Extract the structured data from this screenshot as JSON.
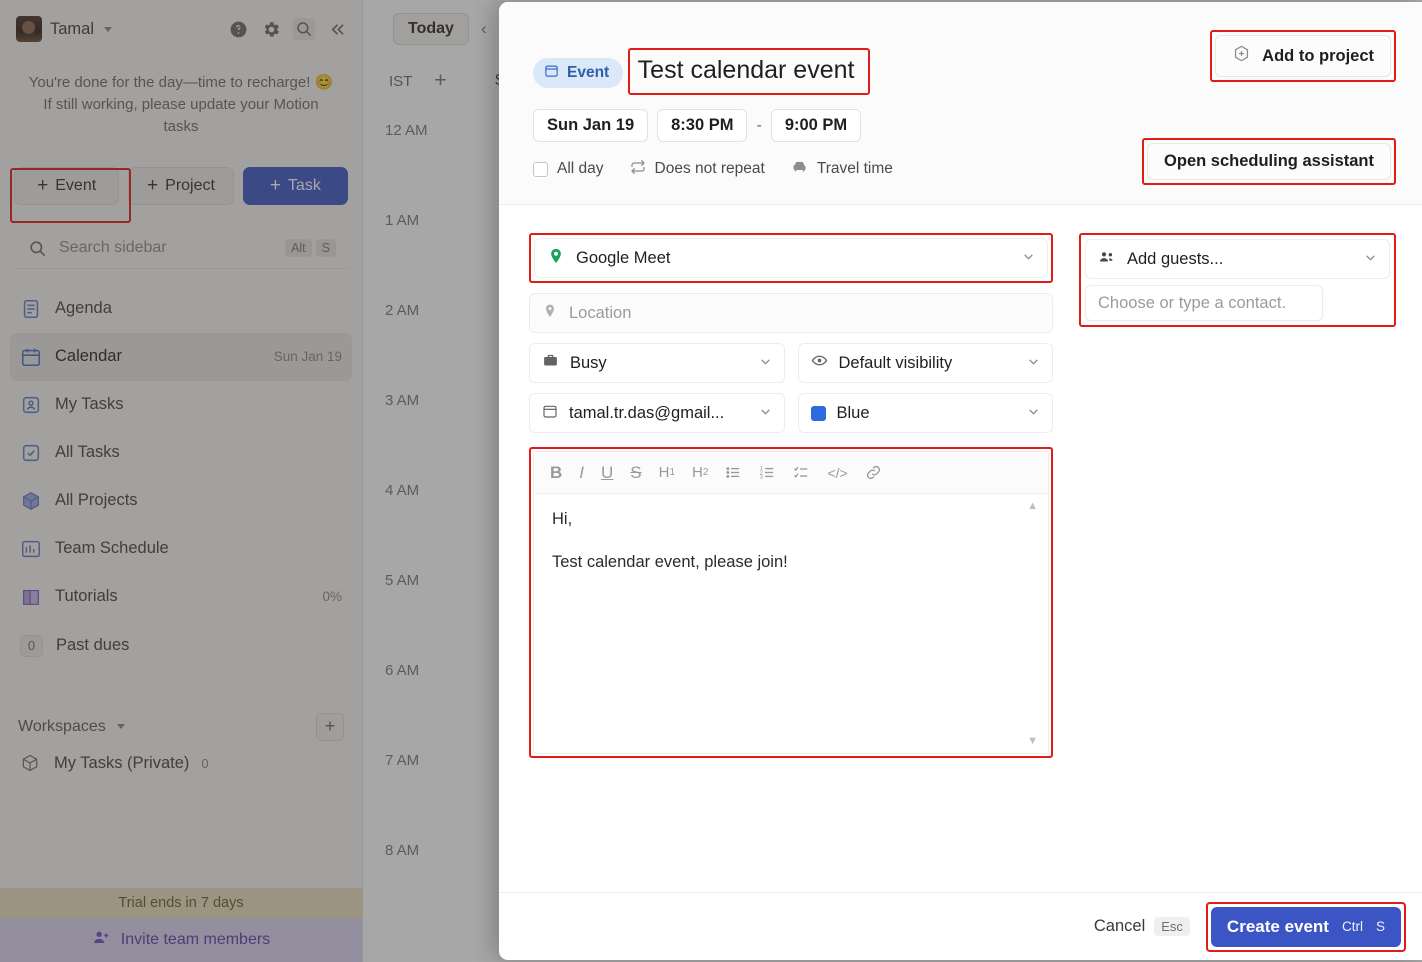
{
  "sidebar": {
    "user": {
      "name": "Tamal",
      "avatar_alt": "user-avatar"
    },
    "top_icons": [
      "help-icon",
      "gear-icon",
      "search-icon",
      "collapse-icon"
    ],
    "notice": "You're done for the day—time to recharge! 😊 If still working, please update your Motion tasks",
    "quick_actions": [
      {
        "label": "Event",
        "icon": "plus-icon",
        "style": "default"
      },
      {
        "label": "Project",
        "icon": "plus-icon",
        "style": "default"
      },
      {
        "label": "Task",
        "icon": "plus-icon",
        "style": "primary"
      }
    ],
    "search": {
      "placeholder": "Search sidebar",
      "shortcut_alt": "Alt",
      "shortcut_key": "S"
    },
    "nav_items": [
      {
        "label": "Agenda",
        "icon": "agenda-icon",
        "meta": "",
        "active": false
      },
      {
        "label": "Calendar",
        "icon": "calendar-icon",
        "meta": "Sun Jan 19",
        "active": true
      },
      {
        "label": "My Tasks",
        "icon": "my-tasks-icon",
        "meta": "",
        "active": false
      },
      {
        "label": "All Tasks",
        "icon": "all-tasks-icon",
        "meta": "",
        "active": false
      },
      {
        "label": "All Projects",
        "icon": "all-projects-icon",
        "meta": "",
        "active": false
      },
      {
        "label": "Team Schedule",
        "icon": "team-schedule-icon",
        "meta": "",
        "active": false
      },
      {
        "label": "Tutorials",
        "icon": "tutorials-icon",
        "meta": "0%",
        "active": false
      }
    ],
    "past_dues": {
      "count": "0",
      "label": "Past dues"
    },
    "workspaces": {
      "header": "Workspaces",
      "add_label": "+",
      "items": [
        {
          "label": "My Tasks (Private)",
          "count": "0"
        }
      ]
    },
    "trial_banner": "Trial ends in 7 days",
    "invite_label": "Invite team members"
  },
  "calendar": {
    "today_label": "Today",
    "prev_arrow": "‹",
    "timezone": "IST",
    "add_timezone": "+",
    "day_label": "S",
    "hours": [
      "12 AM",
      "1 AM",
      "2 AM",
      "3 AM",
      "4 AM",
      "5 AM",
      "6 AM",
      "7 AM",
      "8 AM"
    ]
  },
  "modal": {
    "type_badge": {
      "label": "Event",
      "icon": "calendar-icon"
    },
    "title": "Test calendar event",
    "date": "Sun Jan 19",
    "start_time": "8:30 PM",
    "time_separator": "-",
    "end_time": "9:00 PM",
    "options": [
      {
        "label": "All day",
        "icon": "checkbox-icon"
      },
      {
        "label": "Does not repeat",
        "icon": "repeat-icon"
      },
      {
        "label": "Travel time",
        "icon": "car-icon"
      }
    ],
    "add_to_project": {
      "label": "Add to project",
      "icon": "plus-hex-icon"
    },
    "scheduling_assistant": {
      "label": "Open scheduling assistant"
    },
    "conference": {
      "value": "Google Meet",
      "icon": "google-meet-icon"
    },
    "location": {
      "placeholder": "Location",
      "icon": "pin-icon"
    },
    "availability": {
      "value": "Busy",
      "icon": "briefcase-icon"
    },
    "visibility": {
      "value": "Default visibility",
      "icon": "eye-icon"
    },
    "calendar_account": {
      "value": "tamal.tr.das@gmail...",
      "icon": "calendar-icon"
    },
    "color": {
      "value": "Blue",
      "hex": "#2f6be0"
    },
    "guests": {
      "label": "Add guests...",
      "icon": "people-icon",
      "input_placeholder": "Choose or type a contact."
    },
    "editor": {
      "toolbar": [
        {
          "name": "bold-icon",
          "glyph": "B"
        },
        {
          "name": "italic-icon",
          "glyph": "I"
        },
        {
          "name": "underline-icon",
          "glyph": "U"
        },
        {
          "name": "strikethrough-icon",
          "glyph": "S"
        },
        {
          "name": "heading-1-icon",
          "glyph": "H1"
        },
        {
          "name": "heading-2-icon",
          "glyph": "H2"
        },
        {
          "name": "bullet-list-icon",
          "glyph": "☰"
        },
        {
          "name": "numbered-list-icon",
          "glyph": "☰"
        },
        {
          "name": "checklist-icon",
          "glyph": "☰"
        },
        {
          "name": "code-icon",
          "glyph": "</>"
        },
        {
          "name": "link-icon",
          "glyph": "🔗"
        }
      ],
      "lines": [
        "Hi,",
        "Test calendar event, please join!"
      ]
    },
    "footer": {
      "cancel_label": "Cancel",
      "cancel_shortcut": "Esc",
      "create_label": "Create event",
      "create_shortcut_mod": "Ctrl",
      "create_shortcut_key": "S"
    }
  },
  "colors": {
    "accent": "#3b55c4",
    "highlight_outline": "#e01b18",
    "badge_bg": "#dbe8fa",
    "event_color": "#2f6be0",
    "trial_bg": "#e8dcb9",
    "invite_bg": "#ddd3ef"
  }
}
